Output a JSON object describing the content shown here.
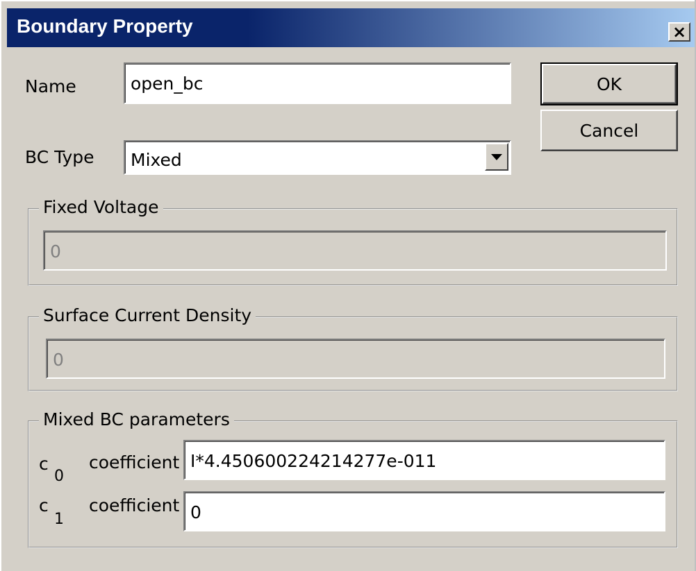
{
  "window": {
    "title": "Boundary Property",
    "close_glyph": "×"
  },
  "form": {
    "name_label": "Name",
    "name_value": "open_bc",
    "bctype_label": "BC Type",
    "bctype_value": "Mixed"
  },
  "buttons": {
    "ok": "OK",
    "cancel": "Cancel"
  },
  "fixed_voltage": {
    "legend": "Fixed Voltage",
    "value": "0"
  },
  "surface_current": {
    "legend": "Surface Current Density",
    "value": "0"
  },
  "mixed": {
    "legend": "Mixed BC parameters",
    "c0_letter": "c",
    "c0_sub": "0",
    "c0_label": "coefficient",
    "c0_value": "I*4.450600224214277e-011",
    "c1_letter": "c",
    "c1_sub": "1",
    "c1_label": "coefficient",
    "c1_value": "0"
  },
  "colors": {
    "titlebar_start": "#0a246a",
    "titlebar_end": "#a6caf0",
    "dialog_bg": "#d4d0c8"
  },
  "icons": {
    "close": "close-icon",
    "dropdown": "chevron-down-icon"
  }
}
